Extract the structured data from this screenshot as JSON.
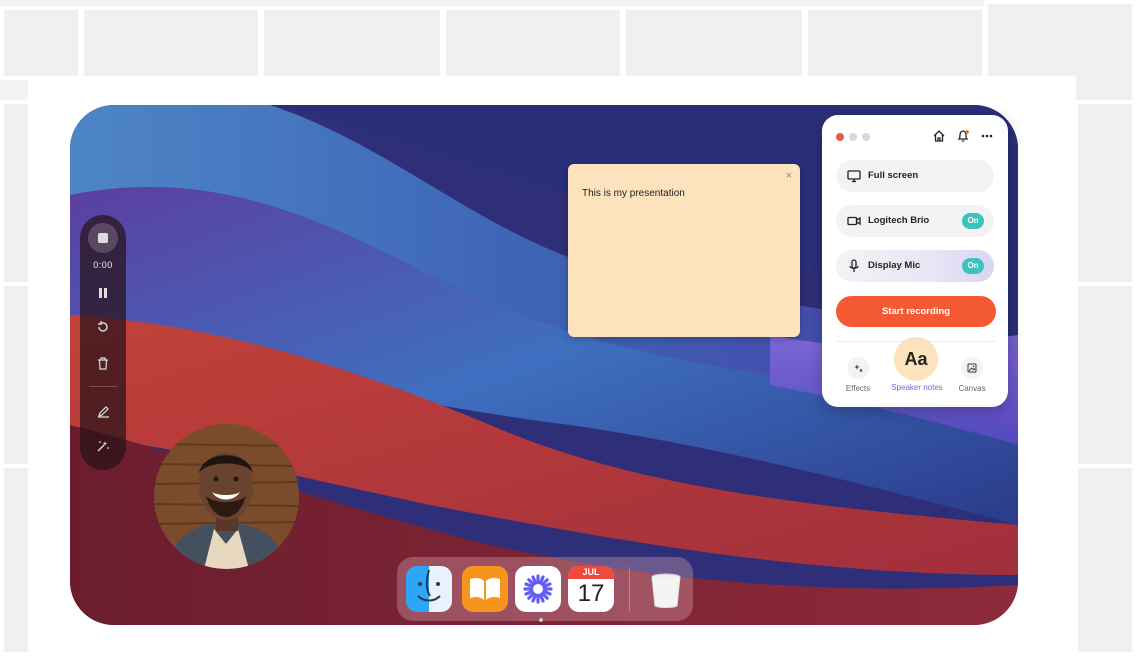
{
  "recorder": {
    "time": "0:00"
  },
  "note": {
    "text": "This is my presentation",
    "close_glyph": "×"
  },
  "panel": {
    "rows": [
      {
        "label": "Full screen",
        "icon": "monitor-icon"
      },
      {
        "label": "Logitech Brio",
        "icon": "camera-icon",
        "toggle": "On"
      },
      {
        "label": "Display Mic",
        "icon": "mic-icon",
        "toggle": "On"
      }
    ],
    "start_label": "Start recording",
    "tools": [
      {
        "label": "Effects",
        "icon": "sparkle-icon"
      },
      {
        "label": "Speaker notes",
        "icon": "text-icon",
        "glyph": "Aa"
      },
      {
        "label": "Canvas",
        "icon": "image-icon"
      }
    ]
  },
  "dock": {
    "calendar_month": "JUL",
    "calendar_day": "17",
    "apps": [
      "finder-icon",
      "books-icon",
      "app-icon",
      "calendar-icon",
      "trash-icon"
    ]
  },
  "colors": {
    "accent": "#f35a34",
    "toggle": "#3cc3bd",
    "note": "#fde3bd",
    "speaker_notes_label": "#6b6bd8"
  }
}
